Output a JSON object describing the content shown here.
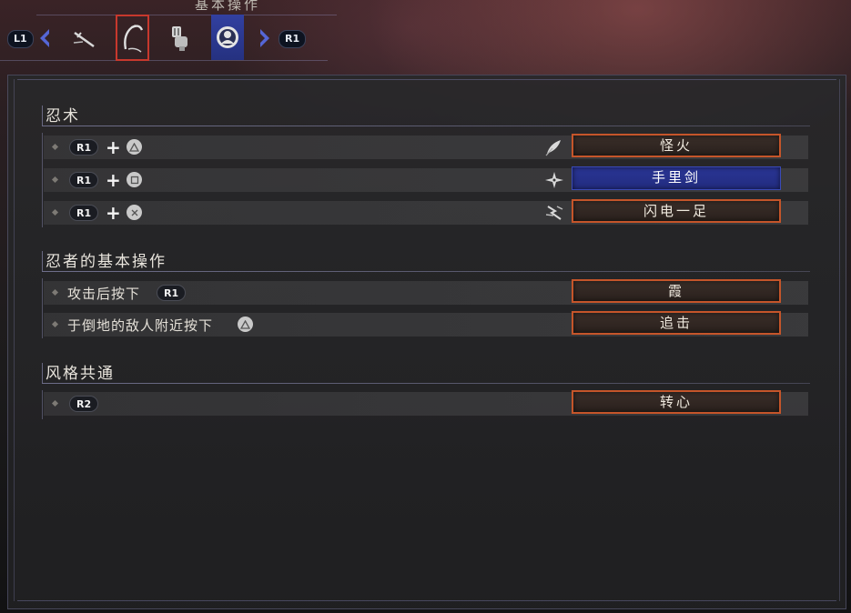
{
  "header": {
    "title": "基本操作",
    "left_button": "L1",
    "right_button": "R1",
    "tabs": [
      {
        "icon": "sword-icon"
      },
      {
        "icon": "grappling-hook-icon"
      },
      {
        "icon": "prosthetic-arm-icon"
      },
      {
        "icon": "ninja-emblem-icon"
      }
    ]
  },
  "sections": [
    {
      "title": "忍术",
      "rows": [
        {
          "button": "R1",
          "face": "triangle",
          "skill_icon": "feather-icon",
          "skill": "怪火"
        },
        {
          "button": "R1",
          "face": "square",
          "skill_icon": "shuriken-icon",
          "skill": "手里剑"
        },
        {
          "button": "R1",
          "face": "cross",
          "skill_icon": "lightning-kick-icon",
          "skill": "闪电一足"
        }
      ]
    },
    {
      "title": "忍者的基本操作",
      "rows": [
        {
          "text": "攻击后按下",
          "button": "R1",
          "skill": "霞"
        },
        {
          "text": "于倒地的敌人附近按下",
          "face": "triangle",
          "skill": "追击"
        }
      ]
    },
    {
      "title": "风格共通",
      "rows": [
        {
          "button": "R2",
          "skill": "转心"
        }
      ]
    }
  ],
  "colors": {
    "accent_orange": "#c5552a",
    "accent_blue": "#2a3595",
    "selected_tab_border": "#c7382d"
  }
}
